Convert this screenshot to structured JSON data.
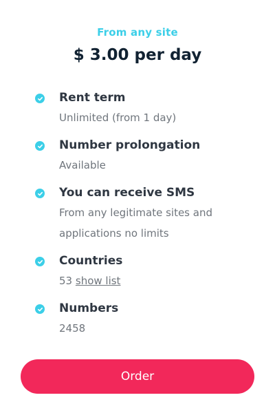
{
  "header": {
    "subtitle": "From any site",
    "price": "$ 3.00 per day"
  },
  "features": [
    {
      "label": "Rent term",
      "value": "Unlimited (from 1 day)"
    },
    {
      "label": "Number prolongation",
      "value": "Available"
    },
    {
      "label": "You can receive SMS",
      "value": "From any legitimate sites and applications no limits"
    },
    {
      "label": "Countries",
      "value": "53",
      "link": "show list"
    },
    {
      "label": "Numbers",
      "value": "2458"
    }
  ],
  "order_button": {
    "label": "Order"
  },
  "colors": {
    "accent": "#3ccfe8",
    "button": "#f2285a",
    "title": "#112232"
  },
  "icons": {
    "check": "check-circle-icon"
  }
}
